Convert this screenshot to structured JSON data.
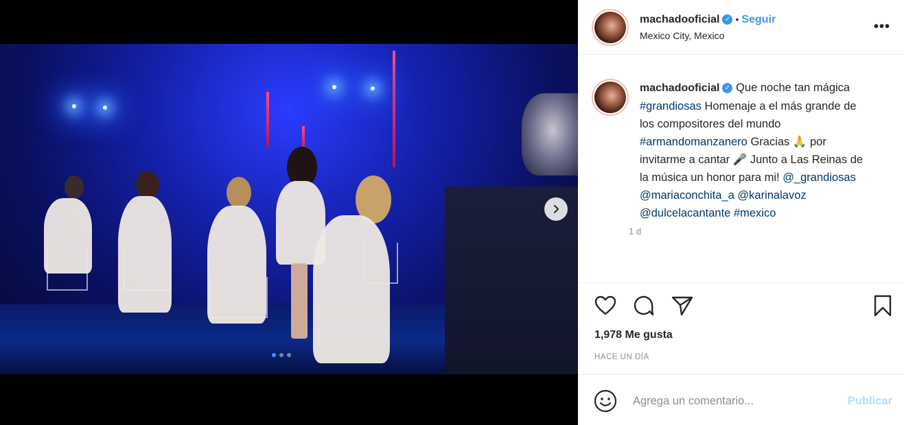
{
  "post": {
    "username": "machadooficial",
    "separator": "•",
    "follow_label": "Seguir",
    "location": "Mexico City, Mexico",
    "more_label": "•••"
  },
  "caption": {
    "username": "machadooficial",
    "parts": [
      {
        "text": " Que noche tan mágica ",
        "tag": false
      },
      {
        "text": "#grandiosas",
        "tag": true
      },
      {
        "text": " Homenaje a el más grande de los compositores del mundo ",
        "tag": false
      },
      {
        "text": "#armandomanzanero",
        "tag": true
      },
      {
        "text": " Gracias 🙏 por invitarme a cantar 🎤 Junto a Las Reinas de la música un honor para mi! ",
        "tag": false
      },
      {
        "text": "@_grandiosas",
        "tag": true
      },
      {
        "text": " ",
        "tag": false
      },
      {
        "text": "@mariaconchita_a",
        "tag": true
      },
      {
        "text": " ",
        "tag": false
      },
      {
        "text": "@karinalavoz",
        "tag": true
      },
      {
        "text": " ",
        "tag": false
      },
      {
        "text": "@dulcelacantante",
        "tag": true
      },
      {
        "text": " ",
        "tag": false
      },
      {
        "text": "#mexico",
        "tag": true
      }
    ],
    "time": "1 d"
  },
  "stats": {
    "likes": "1,978 Me gusta",
    "time_ago": "HACE UN DÍA"
  },
  "comment": {
    "placeholder": "Agrega un comentario...",
    "publish_label": "Publicar"
  },
  "carousel": {
    "dots": 3,
    "active_index": 0
  },
  "icons": {
    "like": "heart-icon",
    "comment": "comment-icon",
    "share": "share-icon",
    "save": "bookmark-icon",
    "emoji": "emoji-icon",
    "next": "chevron-right-icon",
    "verified": "verified-badge-icon"
  },
  "colors": {
    "link_blue": "#3897f0",
    "hashtag": "#00376b",
    "muted": "#8e8e8e",
    "publish_disabled": "#b2dffc"
  }
}
